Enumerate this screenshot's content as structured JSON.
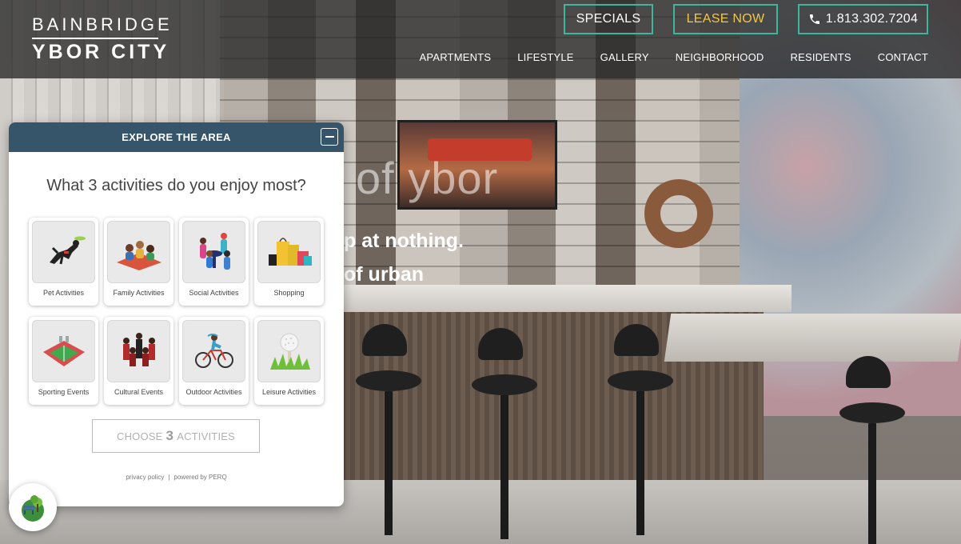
{
  "brand": {
    "line1": "BAINBRIDGE",
    "line2": "YBOR CITY"
  },
  "header": {
    "specials": "SPECIALS",
    "lease_now": "LEASE NOW",
    "phone": "1.813.302.7204",
    "nav": [
      "APARTMENTS",
      "LIFESTYLE",
      "GALLERY",
      "NEIGHBORHOOD",
      "RESIDENTS",
      "CONTACT"
    ]
  },
  "hero": {
    "text1": "of ybor",
    "text2": "p at nothing.",
    "text3": "of urban"
  },
  "widget": {
    "title": "EXPLORE THE AREA",
    "question": "What 3 activities do you enjoy most?",
    "activities": [
      {
        "label": "Pet Activities",
        "icon": "dog-frisbee-icon"
      },
      {
        "label": "Family Activities",
        "icon": "family-picnic-icon"
      },
      {
        "label": "Social Activities",
        "icon": "people-table-icon"
      },
      {
        "label": "Shopping",
        "icon": "shopping-bags-icon"
      },
      {
        "label": "Sporting Events",
        "icon": "stadium-icon"
      },
      {
        "label": "Cultural Events",
        "icon": "orchestra-icon"
      },
      {
        "label": "Outdoor Activities",
        "icon": "cyclist-icon"
      },
      {
        "label": "Leisure Activities",
        "icon": "golf-ball-icon"
      }
    ],
    "choose": {
      "prefix": "CHOOSE",
      "count": "3",
      "suffix": "ACTIVITIES"
    },
    "footer": {
      "privacy": "privacy policy",
      "powered": "powered by PERQ"
    }
  },
  "colors": {
    "accent": "#3fb59b",
    "lease": "#f2c744",
    "widget_header": "#36556a"
  }
}
